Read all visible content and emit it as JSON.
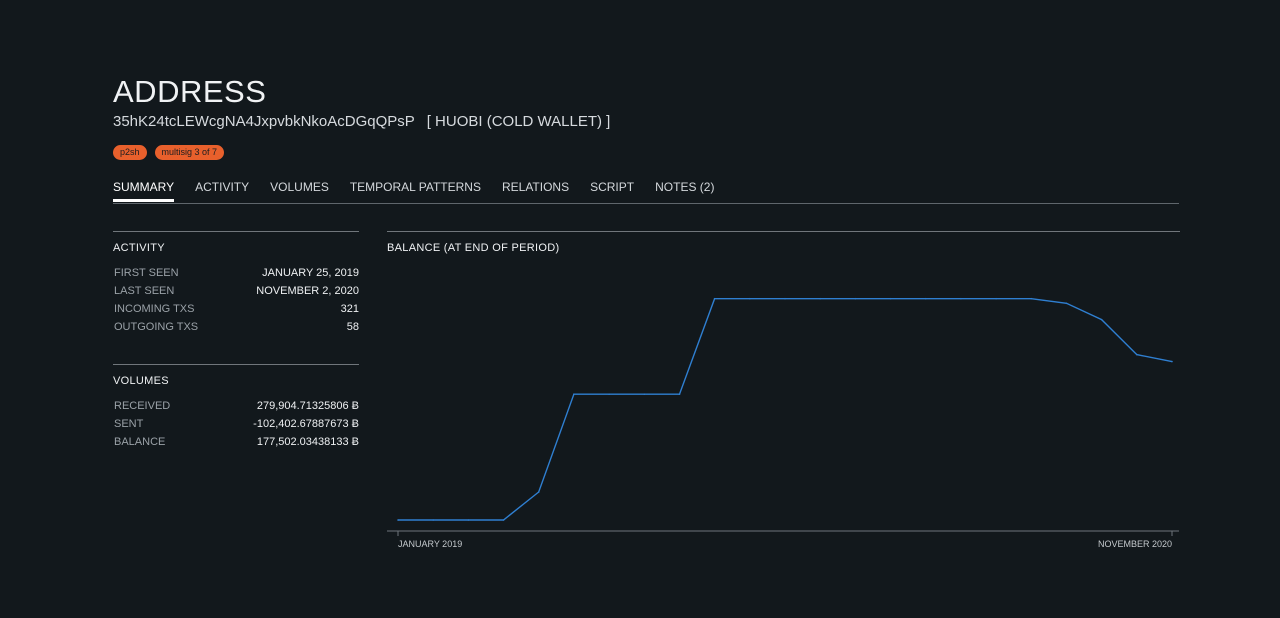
{
  "page": {
    "title": "ADDRESS",
    "address": "35hK24tcLEWcgNA4JxpvbkNkoAcDGqQPsP",
    "label": "[ HUOBI (COLD WALLET) ]",
    "badges": [
      "p2sh",
      "multisig 3 of 7"
    ]
  },
  "tabs": [
    {
      "label": "SUMMARY",
      "active": true
    },
    {
      "label": "ACTIVITY",
      "active": false
    },
    {
      "label": "VOLUMES",
      "active": false
    },
    {
      "label": "TEMPORAL PATTERNS",
      "active": false
    },
    {
      "label": "RELATIONS",
      "active": false
    },
    {
      "label": "SCRIPT",
      "active": false
    },
    {
      "label": "NOTES (2)",
      "active": false
    }
  ],
  "activity": {
    "title": "ACTIVITY",
    "rows": [
      {
        "key": "FIRST SEEN",
        "value": "JANUARY 25, 2019"
      },
      {
        "key": "LAST SEEN",
        "value": "NOVEMBER 2, 2020"
      },
      {
        "key": "INCOMING TXS",
        "value": "321"
      },
      {
        "key": "OUTGOING TXS",
        "value": "58"
      }
    ]
  },
  "volumes": {
    "title": "VOLUMES",
    "rows": [
      {
        "key": "RECEIVED",
        "value": "279,904.71325806 Ƀ"
      },
      {
        "key": "SENT",
        "value": "-102,402.67887673 Ƀ"
      },
      {
        "key": "BALANCE",
        "value": "177,502.03438133 Ƀ"
      }
    ]
  },
  "chart_data": {
    "type": "line",
    "title": "BALANCE (AT END OF PERIOD)",
    "x_tick_labels": [
      "JANUARY 2019",
      "NOVEMBER 2020"
    ],
    "x": [
      0,
      1,
      2,
      3,
      4,
      5,
      6,
      7,
      8,
      9,
      10,
      11,
      12,
      13,
      14,
      15,
      16,
      17,
      18,
      19,
      20,
      21,
      22
    ],
    "values": [
      0,
      0,
      0,
      0,
      12,
      54,
      54,
      54,
      54,
      95,
      95,
      95,
      95,
      95,
      95,
      95,
      95,
      95,
      95,
      93,
      86,
      71,
      68
    ],
    "ylim": [
      0,
      100
    ],
    "line_color": "#2f7fd1",
    "grid": false,
    "legend": "none"
  }
}
